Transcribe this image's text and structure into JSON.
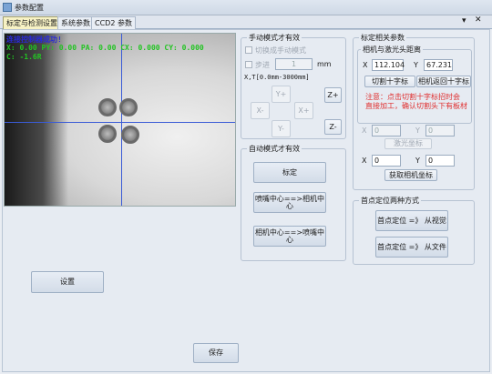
{
  "window": {
    "title": "参数配置",
    "menu_glyph": "▾",
    "close_glyph": "✕"
  },
  "tabs": [
    {
      "label": "标定与检测设置",
      "active": true
    },
    {
      "label": "系统参数",
      "active": false
    },
    {
      "label": "CCD2 参数",
      "active": false
    }
  ],
  "camera": {
    "line1": "连接控制器成功!",
    "line2": "X: 0.00 PY: 0.00 PA: 0.00 CX: 0.000 CY: 0.000",
    "line3": "C: -1.6R"
  },
  "manual": {
    "group_title": "手动模式才有效",
    "switch_label": "切换成手动模式",
    "step_label": "步进",
    "step_value": "1",
    "step_unit": "mm",
    "range_label": "X,T[0.0mm-3000mm]",
    "jog": {
      "y_plus": "Y+",
      "y_minus": "Y-",
      "x_minus": "X-",
      "x_plus": "X+",
      "z_plus": "Z+",
      "z_minus": "Z-"
    }
  },
  "auto": {
    "group_title": "自动模式才有效",
    "calibrate": "标定",
    "nozzle_to_camera": "喷嘴中心==>相机中心",
    "camera_to_nozzle": "相机中心==>喷嘴中心"
  },
  "calib": {
    "group_title": "标定相关参数",
    "distance_title": "相机与激光头距离",
    "x_label": "X",
    "x_value": "112.104",
    "y_label": "Y",
    "y_value": "67.231",
    "cut_cross": "切割十字标",
    "camera_return": "相机返回十字标",
    "note1": "注意：点击切割十字标招时会",
    "note2": "直接加工，确认切割头下有板材",
    "x2_value": "0",
    "y2_value": "0",
    "laser_coord": "激光坐标",
    "x3_value": "0",
    "y3_value": "0",
    "get_camera": "获取相机坐标"
  },
  "origin": {
    "group_title": "首点定位两种方式",
    "from_vision": "首点定位 =》 从视觉",
    "from_file": "首点定位 =》 从文件"
  },
  "footer": {
    "settings": "设置",
    "save": "保存"
  }
}
